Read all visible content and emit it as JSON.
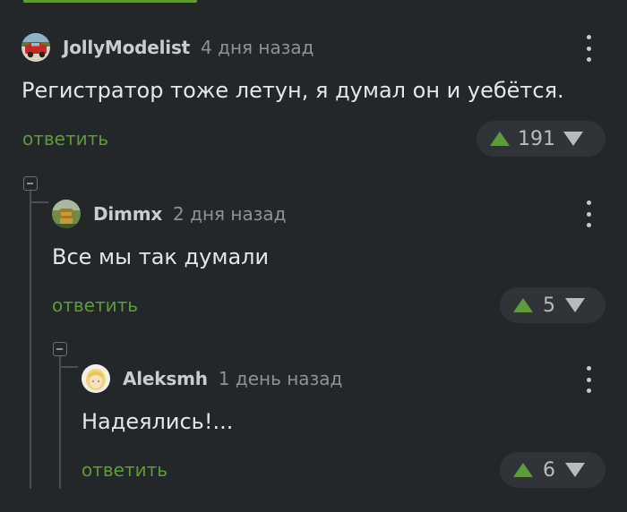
{
  "colors": {
    "background": "#23272a",
    "accent_green": "#5f9a3a",
    "text_primary": "#e4e6e9",
    "text_muted": "#8d9298",
    "pill_bg": "#303438"
  },
  "comments": [
    {
      "username": "JollyModelist",
      "time": "4 дня назад",
      "text": "Регистратор тоже летун, я думал он и уебётся.",
      "reply_label": "ответить",
      "rating": "191",
      "avatar_icon": "red-car-avatar"
    },
    {
      "username": "Dimmx",
      "time": "2 дня назад",
      "text": "Все мы так думали",
      "reply_label": "ответить",
      "rating": "5",
      "avatar_icon": "pagoda-avatar"
    },
    {
      "username": "Aleksmh",
      "time": "1 день назад",
      "text": "Надеялись!...",
      "reply_label": "ответить",
      "rating": "6",
      "avatar_icon": "blonde-avatar"
    }
  ],
  "icons": {
    "menu": "vertical-dots-icon",
    "upvote": "triangle-up-icon",
    "downvote": "triangle-down-icon",
    "collapse": "collapse-minus-icon"
  }
}
